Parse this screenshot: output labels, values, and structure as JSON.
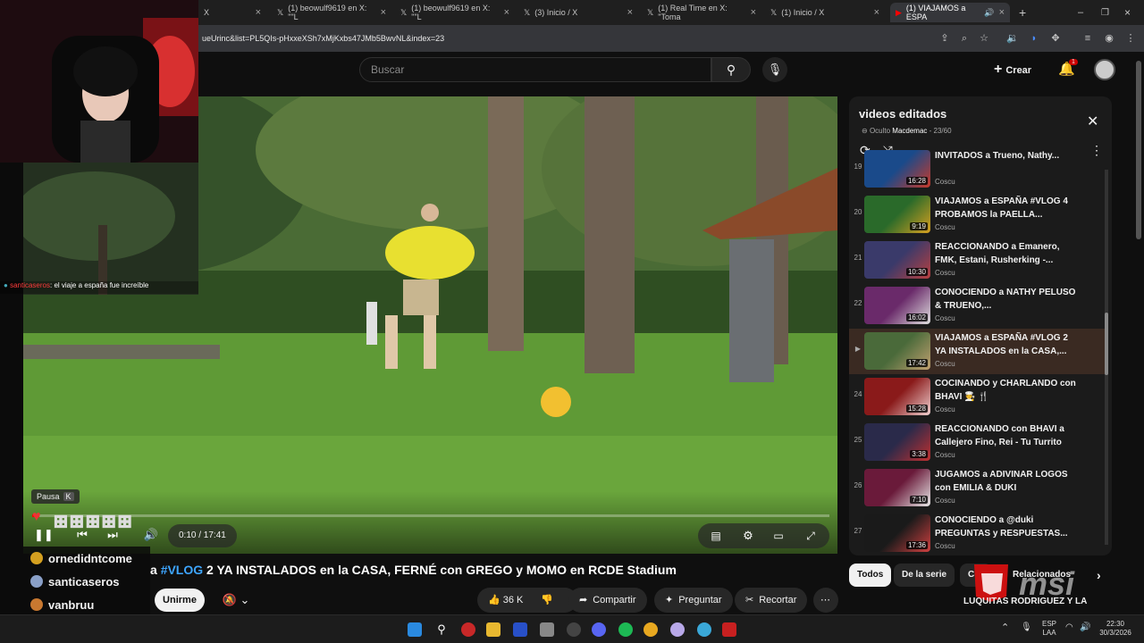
{
  "browser": {
    "tabs": [
      {
        "label": "X"
      },
      {
        "label": "(1) beowulf9619 en X: \"\"L"
      },
      {
        "label": "(1) beowulf9619 en X: \"\"L"
      },
      {
        "label": "(3) Inicio / X"
      },
      {
        "label": "(1) Real Time en X: \"Toma"
      },
      {
        "label": "(1) Inicio / X"
      },
      {
        "label": "(1) VIAJAMOS a ESPA"
      }
    ],
    "url": "ueUrinc&list=PL5QIs-pHxxeXSh7xMjKxbs47JMb5BwvNL&index=23"
  },
  "youtube": {
    "search_placeholder": "Buscar",
    "create_label": "Crear",
    "notif_count": "1"
  },
  "player": {
    "pause_tip": "Pausa",
    "pause_key": "K",
    "time": "0:10 / 17:41",
    "progress": 0.0094
  },
  "video": {
    "title_prefix": "a ",
    "title_tag": "#VLOG",
    "title_rest": " 2 YA INSTALADOS en la CASA, FERNÉ con GREGO y MOMO en RCDE Stadium",
    "join_label": "Unirme",
    "likes": "36 K",
    "share": "Compartir",
    "ask": "Preguntar",
    "clip": "Recortar"
  },
  "stream": {
    "chat_user": "santicaseros",
    "chat_msg": ": el viaje a españa fue increíble",
    "viewers": [
      {
        "name": "ornedidntcome",
        "color": "#d4a020"
      },
      {
        "name": "santicaseros",
        "color": "#8aa0c8"
      },
      {
        "name": "vanbruu",
        "color": "#c87830"
      }
    ]
  },
  "playlist": {
    "title": "videos editados",
    "privacy": "Oculto",
    "owner": "Macdemac",
    "position": "23/60",
    "items": [
      {
        "n": "19",
        "title": "INVITADOS a Trueno, Nathy...",
        "channel": "Coscu",
        "dur": "16:28",
        "c1": "#1a4a8a",
        "c2": "#c83a2a"
      },
      {
        "n": "20",
        "title": "VIAJAMOS a ESPAÑA #VLOG 4 PROBAMOS la PAELLA...",
        "channel": "Coscu",
        "dur": "9:19",
        "c1": "#2a6a2a",
        "c2": "#d8a020"
      },
      {
        "n": "21",
        "title": "REACCIONANDO a Emanero, FMK, Estani, Rusherking -...",
        "channel": "Coscu",
        "dur": "10:30",
        "c1": "#3a3a6a",
        "c2": "#b84040"
      },
      {
        "n": "22",
        "title": "CONOCIENDO a NATHY PELUSO & TRUENO,...",
        "channel": "Coscu",
        "dur": "16:02",
        "c1": "#6a2a6a",
        "c2": "#e0e0e0"
      },
      {
        "n": "",
        "title": "VIAJAMOS a ESPAÑA #VLOG 2 YA INSTALADOS en la CASA,...",
        "channel": "Coscu",
        "dur": "17:42",
        "c1": "#4a6a3a",
        "c2": "#c0a070"
      },
      {
        "n": "24",
        "title": "COCINANDO y CHARLANDO con BHAVI 🧑‍🍳 🍴",
        "channel": "Coscu",
        "dur": "15:28",
        "c1": "#8a1a1a",
        "c2": "#f0d0d0"
      },
      {
        "n": "25",
        "title": "REACCIONANDO con BHAVI a Callejero Fino, Rei - Tu Turrito",
        "channel": "Coscu",
        "dur": "3:38",
        "c1": "#2a2a4a",
        "c2": "#c03030"
      },
      {
        "n": "26",
        "title": "JUGAMOS a ADIVINAR LOGOS con EMILIA & DUKI",
        "channel": "Coscu",
        "dur": "7:10",
        "c1": "#6a1a3a",
        "c2": "#e8e8e8"
      },
      {
        "n": "27",
        "title": "CONOCIENDO a @duki PREGUNTAS y RESPUESTAS...",
        "channel": "Coscu",
        "dur": "17:36",
        "c1": "#1a1a1a",
        "c2": "#d04040"
      }
    ]
  },
  "chips": [
    "Todos",
    "De la serie",
    "Co",
    "Relacionados"
  ],
  "next_rec": "LUQUITAS RODRIGUEZ Y LA",
  "taskbar": {
    "lang": "ESP",
    "layout": "LAA",
    "time": "22:30",
    "date": "30/3/2026"
  }
}
